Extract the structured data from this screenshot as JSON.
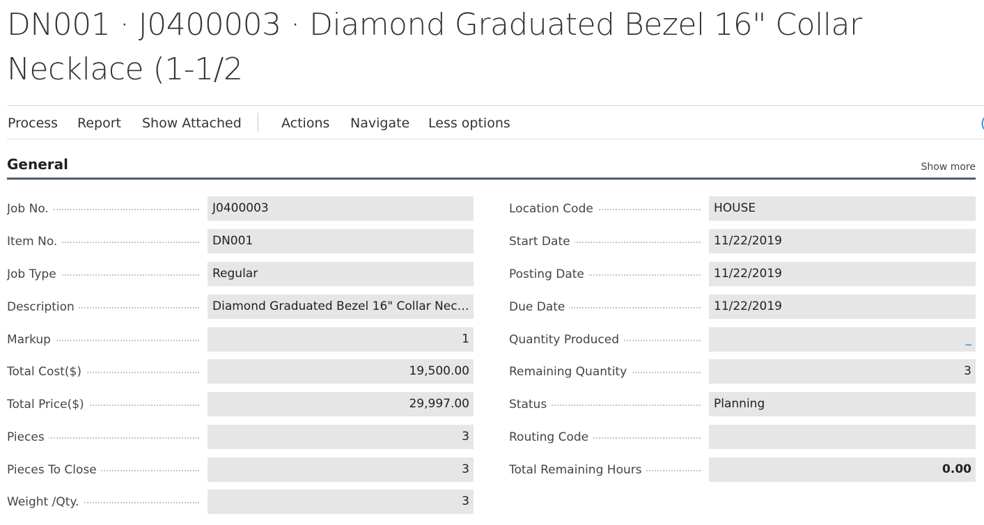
{
  "page": {
    "title": "DN001 · J0400003 · Diamond Graduated Bezel 16\" Collar Necklace (1-1/2"
  },
  "actions": {
    "process": "Process",
    "report": "Report",
    "show_attached": "Show Attached",
    "actions": "Actions",
    "navigate": "Navigate",
    "less_options": "Less options",
    "edge_glyph": "("
  },
  "general": {
    "title": "General",
    "show_more": "Show more",
    "left_fields": [
      {
        "label": "Job No.",
        "value": "J0400003"
      },
      {
        "label": "Item No.",
        "value": "DN001"
      },
      {
        "label": "Job Type",
        "value": "Regular"
      },
      {
        "label": "Description",
        "value": "Diamond Graduated Bezel 16\" Collar Necklace..."
      },
      {
        "label": "Markup",
        "value": "1"
      },
      {
        "label": "Total Cost($)",
        "value": "19,500.00"
      },
      {
        "label": "Total Price($)",
        "value": "29,997.00"
      },
      {
        "label": "Pieces",
        "value": "3"
      },
      {
        "label": "Pieces To Close",
        "value": "3"
      },
      {
        "label": "Weight /Qty.",
        "value": "3"
      }
    ],
    "right_fields": [
      {
        "label": "Location Code",
        "value": "HOUSE"
      },
      {
        "label": "Start Date",
        "value": "11/22/2019"
      },
      {
        "label": "Posting Date",
        "value": "11/22/2019"
      },
      {
        "label": "Due Date",
        "value": "11/22/2019"
      },
      {
        "label": "Quantity Produced",
        "value": "_"
      },
      {
        "label": "Remaining Quantity",
        "value": "3"
      },
      {
        "label": "Status",
        "value": "Planning"
      },
      {
        "label": "Routing Code",
        "value": ""
      },
      {
        "label": "Total Remaining Hours",
        "value": "0.00"
      }
    ]
  },
  "colors": {
    "field_background": "#e6e6e6",
    "section_underline": "#505a6a",
    "link_blue": "#1f7fd0"
  }
}
